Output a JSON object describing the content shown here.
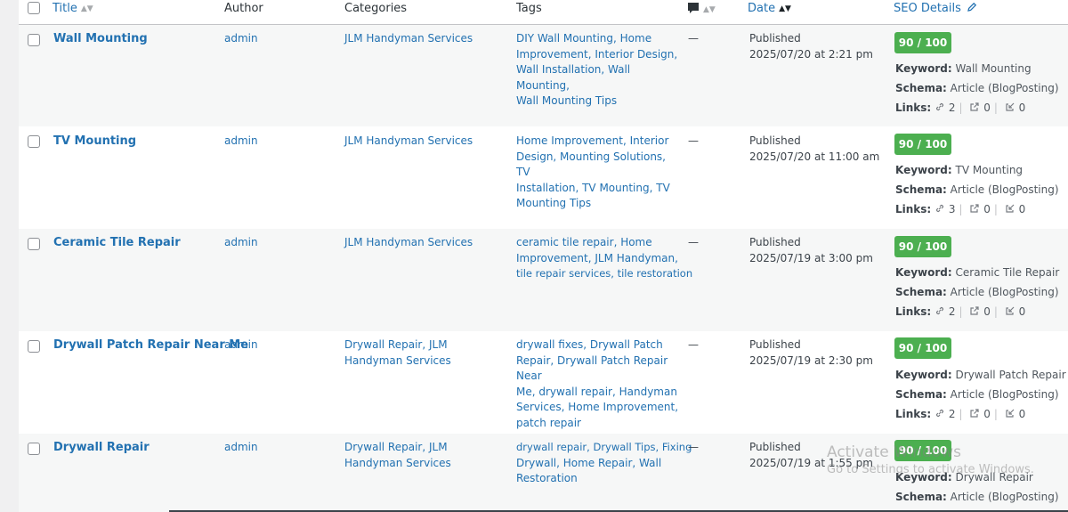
{
  "columns": {
    "title": "Title",
    "author": "Author",
    "categories": "Categories",
    "tags": "Tags",
    "date": "Date",
    "seo": "SEO Details"
  },
  "seo_labels": {
    "keyword": "Keyword:",
    "schema": "Schema:",
    "links": "Links:"
  },
  "rows": [
    {
      "title": "Wall Mounting",
      "author": "admin",
      "categories": "JLM Handyman Services",
      "tags": [
        "DIY Wall Mounting, Home",
        "Improvement, Interior Design,",
        "Wall Installation, Wall Mounting,",
        "Wall Mounting Tips"
      ],
      "comments": "—",
      "status": "Published",
      "date": "2025/07/20 at 2:21 pm",
      "score": "90 / 100",
      "keyword": "Wall Mounting",
      "schema": "Article (BlogPosting)",
      "internal": "2",
      "external": "0",
      "incoming": "0"
    },
    {
      "title": "TV Mounting",
      "author": "admin",
      "categories": "JLM Handyman Services",
      "tags": [
        "Home Improvement, Interior",
        "Design, Mounting Solutions, TV",
        "Installation, TV Mounting, TV",
        "Mounting Tips"
      ],
      "comments": "—",
      "status": "Published",
      "date": "2025/07/20 at 11:00 am",
      "score": "90 / 100",
      "keyword": "TV Mounting",
      "schema": "Article (BlogPosting)",
      "internal": "3",
      "external": "0",
      "incoming": "0"
    },
    {
      "title": "Ceramic Tile Repair",
      "author": "admin",
      "categories": "JLM Handyman Services",
      "tags": [
        "ceramic tile repair, Home",
        "Improvement, JLM Handyman,",
        "tile repair services, tile restoration"
      ],
      "comments": "—",
      "status": "Published",
      "date": "2025/07/19 at 3:00 pm",
      "score": "90 / 100",
      "keyword": "Ceramic Tile Repair",
      "schema": "Article (BlogPosting)",
      "internal": "2",
      "external": "0",
      "incoming": "0"
    },
    {
      "title": "Drywall Patch Repair Near Me",
      "author": "admin",
      "categories": "Drywall Repair, JLM Handyman Services",
      "tags": [
        "drywall fixes, Drywall Patch",
        "Repair, Drywall Patch Repair Near",
        "Me, drywall repair, Handyman",
        "Services, Home Improvement,",
        "patch repair"
      ],
      "comments": "—",
      "status": "Published",
      "date": "2025/07/19 at 2:30 pm",
      "score": "90 / 100",
      "keyword": "Drywall Patch Repair",
      "schema": "Article (BlogPosting)",
      "internal": "2",
      "external": "0",
      "incoming": "0"
    },
    {
      "title": "Drywall Repair",
      "author": "admin",
      "categories": "Drywall Repair, JLM Handyman Services",
      "tags": [
        "drywall repair, Drywall Tips, Fixing",
        "Drywall, Home Repair, Wall",
        "Restoration"
      ],
      "comments": "—",
      "status": "Published",
      "date": "2025/07/19 at 1:55 pm",
      "score": "90 / 100",
      "keyword": "Drywall Repair",
      "schema": "Article (BlogPosting)"
    }
  ],
  "watermark": {
    "line1": "Activate Windows",
    "line2": "Go to Settings to activate Windows."
  },
  "colors": {
    "accent": "#2271b1",
    "score_badge": "#4caf50",
    "text": "#3c434a"
  }
}
